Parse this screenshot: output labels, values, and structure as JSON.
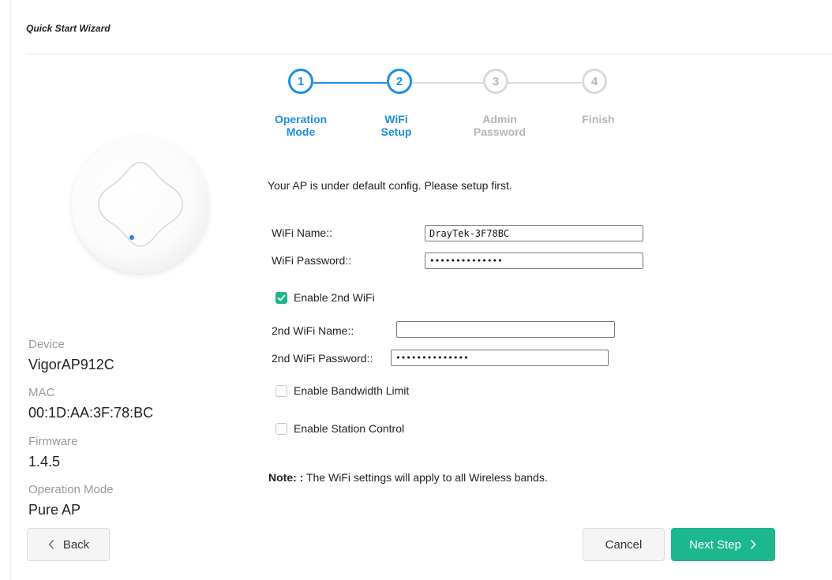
{
  "wizard": {
    "title": "Quick Start Wizard"
  },
  "steps": [
    {
      "number": "1",
      "label_line1": "Operation",
      "label_line2": "Mode",
      "state": "done"
    },
    {
      "number": "2",
      "label_line1": "WiFi",
      "label_line2": "Setup",
      "state": "current"
    },
    {
      "number": "3",
      "label_line1": "Admin",
      "label_line2": "Password",
      "state": "pending"
    },
    {
      "number": "4",
      "label_line1": "Finish",
      "label_line2": "",
      "state": "pending"
    }
  ],
  "device_info": {
    "device_label": "Device",
    "device_value": "VigorAP912C",
    "mac_label": "MAC",
    "mac_value": "00:1D:AA:3F:78:BC",
    "firmware_label": "Firmware",
    "firmware_value": "1.4.5",
    "mode_label": "Operation Mode",
    "mode_value": "Pure AP"
  },
  "form": {
    "intro": "Your AP is under default config. Please setup first.",
    "wifi_name_label": "WiFi Name::",
    "wifi_name_value": "DrayTek-3F78BC",
    "wifi_password_label": "WiFi Password::",
    "wifi_password_value": "••••••••••••••",
    "enable_2nd_label": "Enable 2nd WiFi",
    "enable_2nd_checked": true,
    "wifi2_name_label": "2nd WiFi Name::",
    "wifi2_name_value": "",
    "wifi2_password_label": "2nd WiFi Password::",
    "wifi2_password_value": "••••••••••••••",
    "bandwidth_label": "Enable Bandwidth Limit",
    "bandwidth_checked": false,
    "station_label": "Enable Station Control",
    "station_checked": false,
    "note_prefix": "Note: :",
    "note_text": " The WiFi settings will apply to all Wireless bands."
  },
  "buttons": {
    "back": "Back",
    "cancel": "Cancel",
    "next": "Next Step"
  },
  "colors": {
    "accent_blue": "#1a8fe3",
    "accent_green": "#1cb78d",
    "inactive": "#d9d9d9"
  }
}
